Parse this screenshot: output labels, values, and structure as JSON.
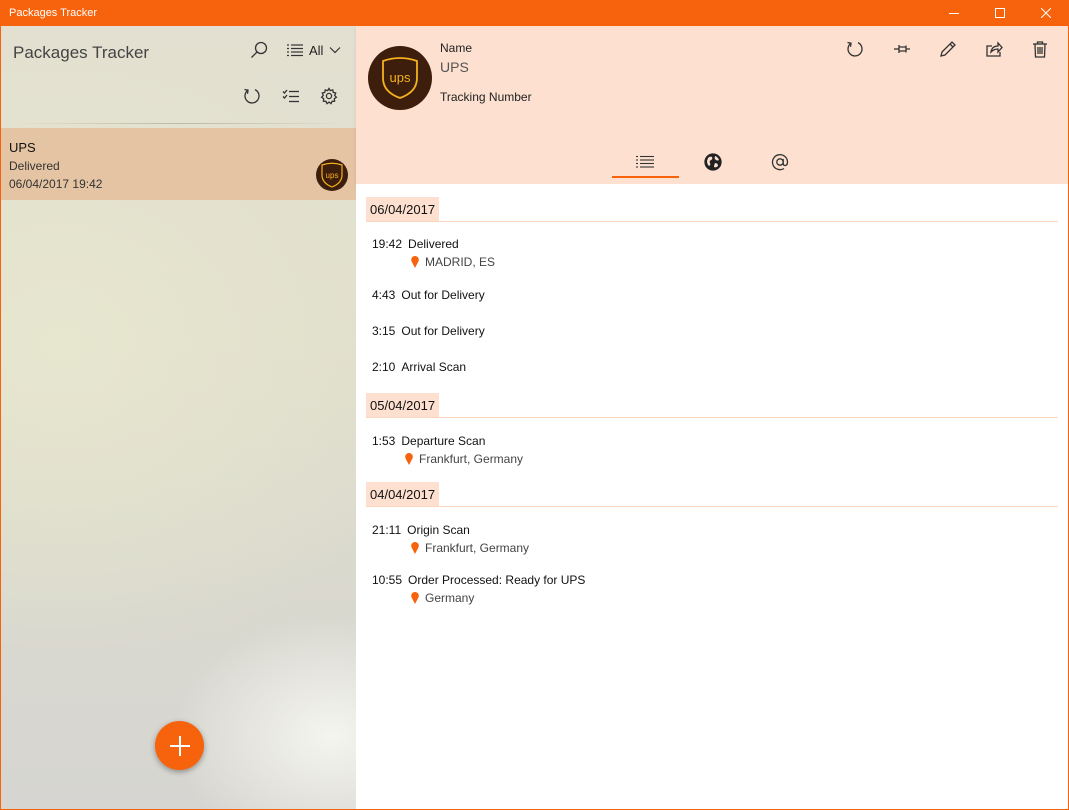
{
  "window": {
    "title": "Packages Tracker",
    "accent_color": "#f7630c"
  },
  "sidebar": {
    "app_title": "Packages Tracker",
    "filter_label": "All",
    "packages": [
      {
        "name": "UPS",
        "status": "Delivered",
        "date": "06/04/2017 19:42",
        "logo_text": "ups"
      }
    ],
    "icons": [
      "search-icon",
      "list-icon",
      "chevron-down-icon",
      "refresh-icon",
      "checklist-icon",
      "gear-icon",
      "add-icon"
    ]
  },
  "detail": {
    "name_label": "Name",
    "name_value": "UPS",
    "tracking_label": "Tracking Number",
    "logo_text": "ups",
    "toolbar_icons": [
      "refresh-icon",
      "pin-icon",
      "edit-icon",
      "share-icon",
      "delete-icon"
    ],
    "tabs": [
      {
        "icon": "list-icon",
        "active": true
      },
      {
        "icon": "globe-icon",
        "active": false
      },
      {
        "icon": "at-icon",
        "active": false
      }
    ]
  },
  "timeline": [
    {
      "date": "06/04/2017",
      "events": [
        {
          "time": "19:42",
          "desc": "Delivered",
          "location": "MADRID, ES"
        },
        {
          "time": "4:43",
          "desc": "Out for Delivery",
          "location": ""
        },
        {
          "time": "3:15",
          "desc": "Out for Delivery",
          "location": ""
        },
        {
          "time": "2:10",
          "desc": "Arrival Scan",
          "location": ""
        }
      ]
    },
    {
      "date": "05/04/2017",
      "events": [
        {
          "time": "1:53",
          "desc": "Departure Scan",
          "location": "Frankfurt, Germany"
        }
      ]
    },
    {
      "date": "04/04/2017",
      "events": [
        {
          "time": "21:11",
          "desc": "Origin Scan",
          "location": "Frankfurt, Germany"
        },
        {
          "time": "10:55",
          "desc": "Order Processed: Ready for UPS",
          "location": "Germany"
        }
      ]
    }
  ]
}
